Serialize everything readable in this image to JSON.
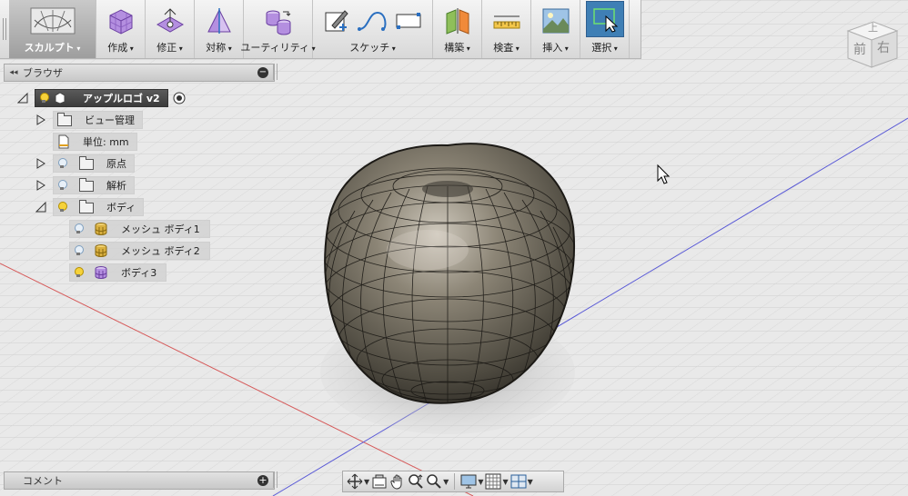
{
  "toolbar": {
    "workspace_label": "スカルプト",
    "groups": [
      {
        "label": "作成",
        "icon": "box-create-icon"
      },
      {
        "label": "修正",
        "icon": "modify-icon"
      },
      {
        "label": "対称",
        "icon": "symmetry-icon"
      },
      {
        "label": "ユーティリティ",
        "icon": "utility-icon"
      },
      {
        "label": "スケッチ",
        "icon": "sketch-icon"
      },
      {
        "label": "構築",
        "icon": "construct-icon"
      },
      {
        "label": "検査",
        "icon": "inspect-icon"
      },
      {
        "label": "挿入",
        "icon": "insert-icon"
      },
      {
        "label": "選択",
        "icon": "select-icon"
      }
    ]
  },
  "browser": {
    "title": "ブラウザ",
    "items": [
      {
        "label": "アップルロゴ v2"
      },
      {
        "label": "ビュー管理"
      },
      {
        "label": "単位: mm"
      },
      {
        "label": "原点"
      },
      {
        "label": "解析"
      },
      {
        "label": "ボディ"
      },
      {
        "label": "メッシュ ボディ1"
      },
      {
        "label": "メッシュ ボディ2"
      },
      {
        "label": "ボディ3"
      }
    ]
  },
  "comments": {
    "title": "コメント"
  },
  "viewcube": {
    "top": "上",
    "front": "前",
    "right": "右"
  },
  "colors": {
    "select_active": "#3f7fb5",
    "x_axis": "#d55",
    "y_axis": "#55c",
    "bulb_on": "#f6d23a"
  }
}
